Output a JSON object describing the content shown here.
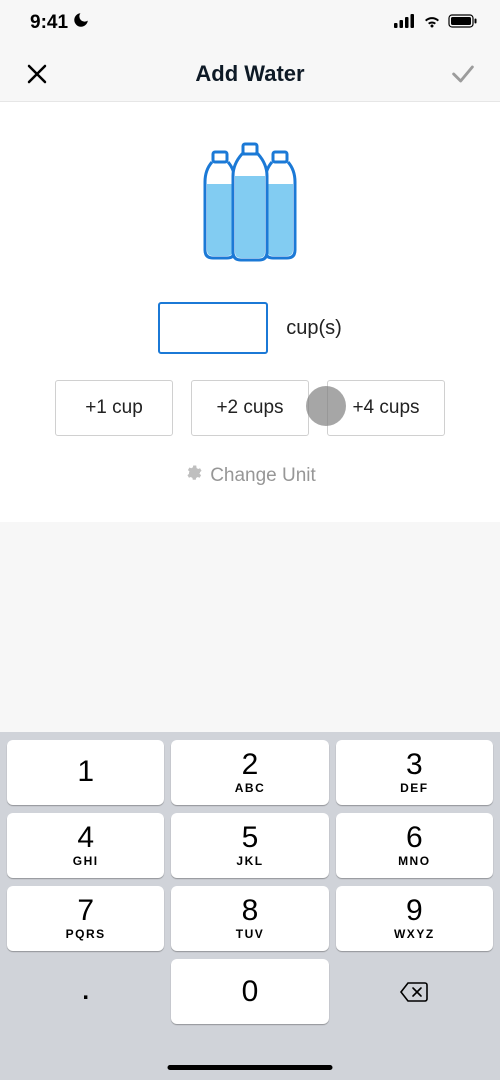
{
  "status_bar": {
    "time": "9:41"
  },
  "header": {
    "title": "Add Water"
  },
  "input": {
    "value": "",
    "placeholder": " ",
    "unit_label": "cup(s)"
  },
  "chips": [
    {
      "label": "+1 cup"
    },
    {
      "label": "+2 cups"
    },
    {
      "label": "+4 cups"
    }
  ],
  "change_unit_label": "Change Unit",
  "keypad": [
    [
      {
        "num": "1",
        "sub": ""
      },
      {
        "num": "2",
        "sub": "ABC"
      },
      {
        "num": "3",
        "sub": "DEF"
      }
    ],
    [
      {
        "num": "4",
        "sub": "GHI"
      },
      {
        "num": "5",
        "sub": "JKL"
      },
      {
        "num": "6",
        "sub": "MNO"
      }
    ],
    [
      {
        "num": "7",
        "sub": "PQRS"
      },
      {
        "num": "8",
        "sub": "TUV"
      },
      {
        "num": "9",
        "sub": "WXYZ"
      }
    ]
  ],
  "keypad_bottom": {
    "dot": ".",
    "zero": "0"
  }
}
